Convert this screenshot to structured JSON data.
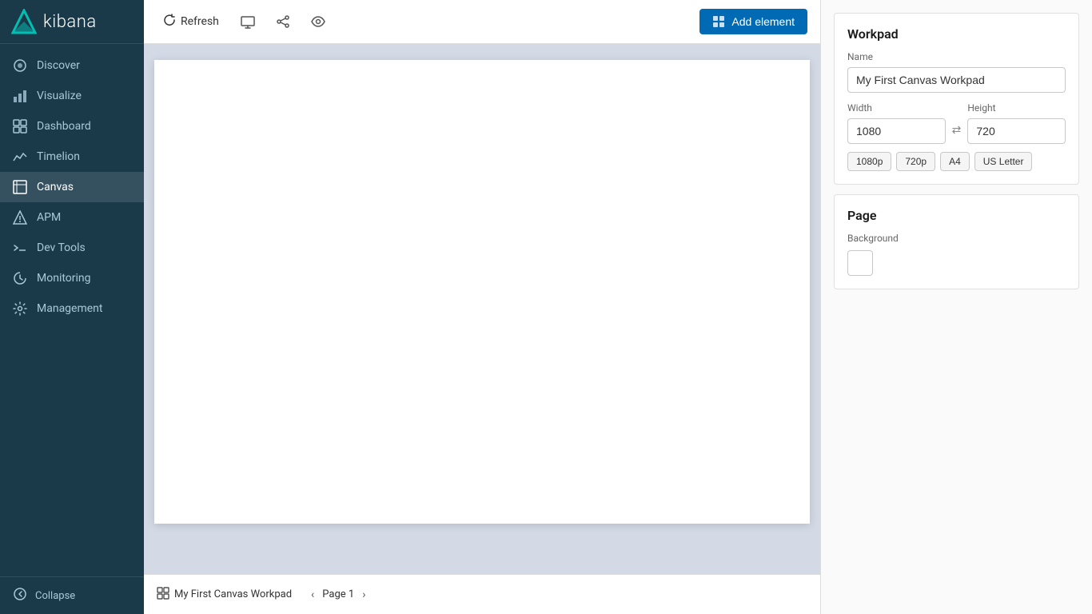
{
  "sidebar": {
    "logo_text": "kibana",
    "items": [
      {
        "id": "discover",
        "label": "Discover",
        "icon": "○"
      },
      {
        "id": "visualize",
        "label": "Visualize",
        "icon": "▦"
      },
      {
        "id": "dashboard",
        "label": "Dashboard",
        "icon": "⊞"
      },
      {
        "id": "timelion",
        "label": "Timelion",
        "icon": "⌇"
      },
      {
        "id": "canvas",
        "label": "Canvas",
        "icon": "⊟",
        "active": true
      },
      {
        "id": "apm",
        "label": "APM",
        "icon": "◈"
      },
      {
        "id": "devtools",
        "label": "Dev Tools",
        "icon": "🔧"
      },
      {
        "id": "monitoring",
        "label": "Monitoring",
        "icon": "♥"
      },
      {
        "id": "management",
        "label": "Management",
        "icon": "⚙"
      }
    ],
    "collapse_label": "Collapse"
  },
  "toolbar": {
    "refresh_label": "Refresh",
    "add_element_label": "Add element"
  },
  "workpad": {
    "name": "My First Canvas Workpad",
    "name_label": "Name",
    "width_label": "Width",
    "height_label": "Height",
    "width_value": "1080",
    "height_value": "720",
    "presets": [
      "1080p",
      "720p",
      "A4",
      "US Letter"
    ],
    "section_title": "Workpad"
  },
  "page": {
    "section_title": "Page",
    "background_label": "Background",
    "page_label": "Page 1",
    "workpad_name": "My First Canvas Workpad"
  }
}
